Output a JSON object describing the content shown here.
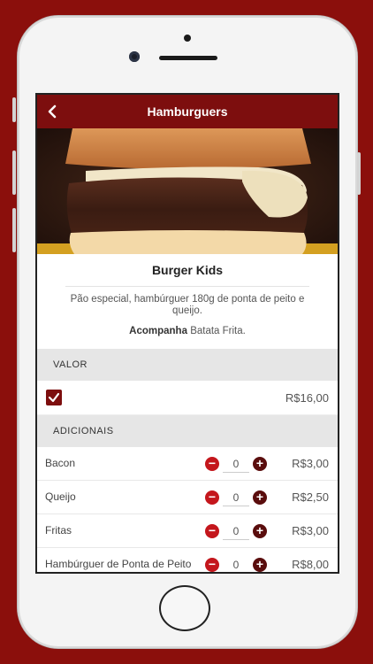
{
  "header": {
    "title": "Hamburguers"
  },
  "product": {
    "name": "Burger Kids",
    "description": "Pão especial, hambúrguer 180g de ponta de peito e queijo.",
    "accompaniment_label": "Acompanha",
    "accompaniment_value": "Batata Frita."
  },
  "valor": {
    "section_label": "VALOR",
    "price": "R$16,00",
    "checked": true
  },
  "adicionais": {
    "section_label": "ADICIONAIS",
    "items": [
      {
        "name": "Bacon",
        "qty": "0",
        "price": "R$3,00"
      },
      {
        "name": "Queijo",
        "qty": "0",
        "price": "R$2,50"
      },
      {
        "name": "Fritas",
        "qty": "0",
        "price": "R$3,00"
      },
      {
        "name": "Hambúrguer de Ponta de Peito",
        "qty": "0",
        "price": "R$8,00"
      }
    ]
  },
  "colors": {
    "background": "#8b0f0c",
    "appbar": "#7d0e0e",
    "minus": "#c4161c",
    "plus": "#5a0d0d"
  }
}
